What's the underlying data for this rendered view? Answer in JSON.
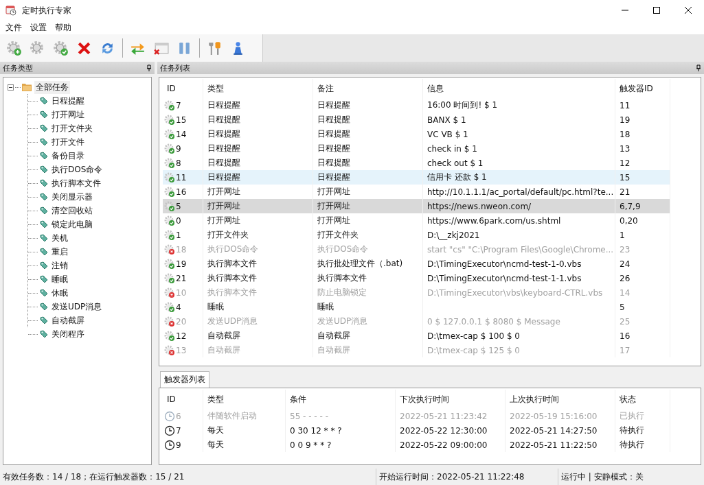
{
  "window": {
    "title": "定时执行专家"
  },
  "menu": [
    "文件",
    "设置",
    "帮助"
  ],
  "toolbar": [
    [
      {
        "kind": "add"
      },
      {
        "kind": "gear"
      },
      {
        "kind": "check"
      },
      {
        "kind": "delete"
      },
      {
        "kind": "refresh"
      }
    ],
    [
      {
        "kind": "swap"
      },
      {
        "kind": "close-window"
      },
      {
        "kind": "pause"
      }
    ],
    [
      {
        "kind": "tools"
      },
      {
        "kind": "pawn"
      }
    ]
  ],
  "task_types": {
    "title": "任务类型",
    "tree": {
      "label": "全部任务",
      "expanded": true,
      "children": [
        {
          "label": "日程提醒"
        },
        {
          "label": "打开网址"
        },
        {
          "label": "打开文件夹"
        },
        {
          "label": "打开文件"
        },
        {
          "label": "备份目录"
        },
        {
          "label": "执行DOS命令"
        },
        {
          "label": "执行脚本文件"
        },
        {
          "label": "关闭显示器"
        },
        {
          "label": "清空回收站"
        },
        {
          "label": "锁定此电脑"
        },
        {
          "label": "关机"
        },
        {
          "label": "重启"
        },
        {
          "label": "注销"
        },
        {
          "label": "睡眠"
        },
        {
          "label": "休眠"
        },
        {
          "label": "发送UDP消息"
        },
        {
          "label": "自动截屏"
        },
        {
          "label": "关闭程序"
        }
      ]
    }
  },
  "tasks": {
    "title": "任务列表",
    "columns": [
      "ID",
      "类型",
      "备注",
      "信息",
      "触发器ID"
    ],
    "rows": [
      {
        "id": "7",
        "type": "日程提醒",
        "note": "日程提醒",
        "info": "16:00 时间到!   $ 1",
        "trigger": "11",
        "enabled": true,
        "selected": false,
        "hovered": false
      },
      {
        "id": "15",
        "type": "日程提醒",
        "note": "日程提醒",
        "info": "BANX $ 1",
        "trigger": "19",
        "enabled": true,
        "selected": false,
        "hovered": false
      },
      {
        "id": "14",
        "type": "日程提醒",
        "note": "日程提醒",
        "info": "VC VB $ 1",
        "trigger": "18",
        "enabled": true,
        "selected": false,
        "hovered": false
      },
      {
        "id": "9",
        "type": "日程提醒",
        "note": "日程提醒",
        "info": "check in $ 1",
        "trigger": "13",
        "enabled": true,
        "selected": false,
        "hovered": false
      },
      {
        "id": "8",
        "type": "日程提醒",
        "note": "日程提醒",
        "info": "check out $ 1",
        "trigger": "12",
        "enabled": true,
        "selected": false,
        "hovered": false
      },
      {
        "id": "11",
        "type": "日程提醒",
        "note": "日程提醒",
        "info": "信用卡 还款 $ 1",
        "trigger": "15",
        "enabled": true,
        "selected": false,
        "hovered": true
      },
      {
        "id": "16",
        "type": "打开网址",
        "note": "打开网址",
        "info": "http://10.1.1.1/ac_portal/default/pc.html?te...",
        "trigger": "21",
        "enabled": true,
        "selected": false,
        "hovered": false
      },
      {
        "id": "5",
        "type": "打开网址",
        "note": "打开网址",
        "info": "https://news.nweon.com/",
        "trigger": "6,7,9",
        "enabled": true,
        "selected": true,
        "hovered": false
      },
      {
        "id": "0",
        "type": "打开网址",
        "note": "打开网址",
        "info": "https://www.6park.com/us.shtml",
        "trigger": "0,20",
        "enabled": true,
        "selected": false,
        "hovered": false
      },
      {
        "id": "1",
        "type": "打开文件夹",
        "note": "打开文件夹",
        "info": "D:\\__zkj2021",
        "trigger": "1",
        "enabled": true,
        "selected": false,
        "hovered": false
      },
      {
        "id": "18",
        "type": "执行DOS命令",
        "note": "执行DOS命令",
        "info": "start \"cs\" \"C:\\Program Files\\Google\\Chrome...",
        "trigger": "23",
        "enabled": false,
        "selected": false,
        "hovered": false
      },
      {
        "id": "19",
        "type": "执行脚本文件",
        "note": "执行批处理文件（.bat)",
        "info": "D:\\TimingExecutor\\ncmd-test-1-0.vbs",
        "trigger": "24",
        "enabled": true,
        "selected": false,
        "hovered": false
      },
      {
        "id": "21",
        "type": "执行脚本文件",
        "note": "执行脚本文件",
        "info": "D:\\TimingExecutor\\ncmd-test-1-1.vbs",
        "trigger": "26",
        "enabled": true,
        "selected": false,
        "hovered": false
      },
      {
        "id": "10",
        "type": "执行脚本文件",
        "note": "防止电脑锁定",
        "info": "D:\\TimingExecutor\\vbs\\keyboard-CTRL.vbs",
        "trigger": "14",
        "enabled": false,
        "selected": false,
        "hovered": false
      },
      {
        "id": "4",
        "type": "睡眠",
        "note": "睡眠",
        "info": "",
        "trigger": "5",
        "enabled": true,
        "selected": false,
        "hovered": false
      },
      {
        "id": "20",
        "type": "发送UDP消息",
        "note": "发送UDP消息",
        "info": "0 $ 127.0.0.1 $ 8080 $ Message",
        "trigger": "25",
        "enabled": false,
        "selected": false,
        "hovered": false
      },
      {
        "id": "12",
        "type": "自动截屏",
        "note": "自动截屏",
        "info": "D:\\tmex-cap $ 100 $ 0",
        "trigger": "16",
        "enabled": true,
        "selected": false,
        "hovered": false
      },
      {
        "id": "13",
        "type": "自动截屏",
        "note": "自动截屏",
        "info": "D:\\tmex-cap $ 125 $ 0",
        "trigger": "17",
        "enabled": false,
        "selected": false,
        "hovered": false
      }
    ]
  },
  "triggers": {
    "tab": "触发器列表",
    "columns": [
      "ID",
      "类型",
      "条件",
      "下次执行时间",
      "上次执行时间",
      "状态"
    ],
    "rows": [
      {
        "id": "6",
        "type": "伴随软件启动",
        "condition": "55 - - - - -",
        "next": "2022-05-21 11:23:42",
        "last": "2022-05-19 15:16:00",
        "status": "已执行",
        "enabled": false
      },
      {
        "id": "7",
        "type": "每天",
        "condition": "0 30 12 * * ?",
        "next": "2022-05-22 12:30:00",
        "last": "2022-05-21 14:27:50",
        "status": "待执行",
        "enabled": true
      },
      {
        "id": "9",
        "type": "每天",
        "condition": "0 0 9 * * ?",
        "next": "2022-05-22 09:00:00",
        "last": "2022-05-21 11:22:50",
        "status": "待执行",
        "enabled": true
      }
    ]
  },
  "status_bar": [
    "有效任务数：14 / 18；在运行触发器数：15 / 21",
    "开始运行时间：2022-05-21 11:22:48",
    "运行中 | 安静模式：关"
  ]
}
